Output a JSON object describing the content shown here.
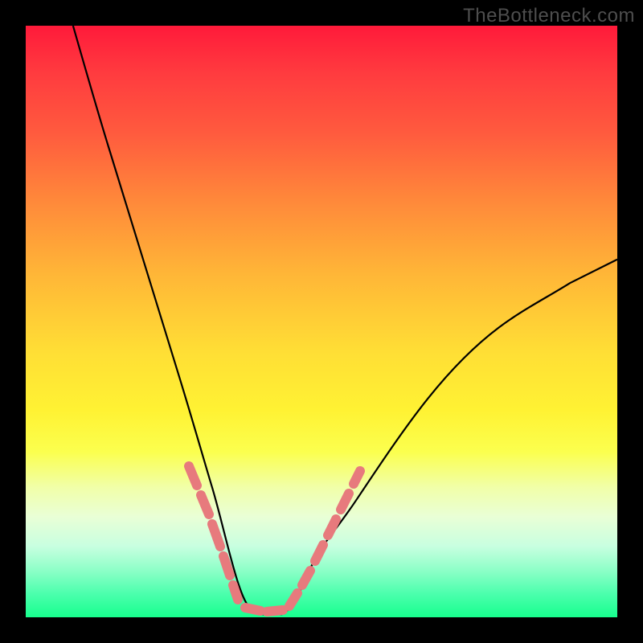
{
  "watermark": "TheBottleneck.com",
  "colors": {
    "background": "#000000",
    "curve": "#000000",
    "optimal_marker": "#e77a7d",
    "gradient_top": "#ff1a3a",
    "gradient_bottom": "#17ff8e"
  },
  "chart_data": {
    "type": "line",
    "title": "",
    "xlabel": "",
    "ylabel": "",
    "xlim": [
      0,
      100
    ],
    "ylim": [
      0,
      100
    ],
    "series": [
      {
        "name": "bottleneck_curve",
        "x": [
          8,
          10,
          12,
          14,
          16,
          18,
          20,
          22,
          24,
          26,
          28,
          30,
          31.5,
          33,
          34.5,
          36,
          38,
          40,
          42,
          44,
          46,
          48,
          52,
          56,
          60,
          66,
          72,
          78,
          84,
          90,
          96,
          100
        ],
        "y": [
          100,
          93,
          86,
          79.5,
          73,
          66.5,
          60,
          53.5,
          47,
          40.5,
          34,
          27,
          22,
          16,
          10,
          5.5,
          2,
          0.5,
          0.5,
          1.5,
          4,
          8,
          14,
          20,
          26,
          33,
          39,
          44.5,
          49,
          53,
          56.5,
          58.5
        ]
      }
    ],
    "optimal_range_markers": {
      "left_segment_x": [
        27.5,
        36
      ],
      "right_segment_x": [
        44,
        54
      ],
      "flat_zone_x": [
        36,
        44
      ]
    },
    "grid": false,
    "legend": false
  }
}
